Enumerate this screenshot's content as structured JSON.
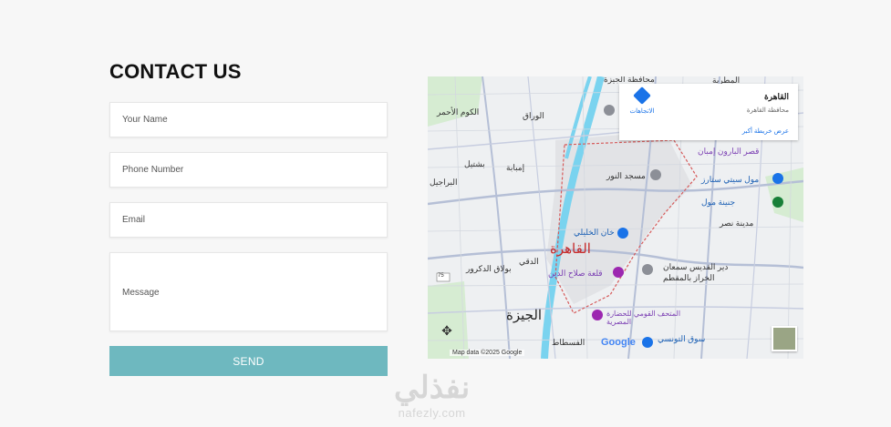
{
  "form": {
    "title": "CONTACT US",
    "name_placeholder": "Your Name",
    "phone_placeholder": "Phone Number",
    "email_placeholder": "Email",
    "message_placeholder": "Message",
    "send_label": "SEND"
  },
  "map": {
    "card_title": "القاهرة",
    "card_subtitle": "محافظة القاهرة",
    "directions_label": "الاتجاهات",
    "larger_map_link": "عرض خريطة أكبر",
    "city_label": "القاهرة",
    "giza_label": "الجيزة",
    "labels": {
      "giza_gov": "محافظة الجيزة",
      "mataria": "المطرية",
      "kom_ahmar": "الكوم الأحمر",
      "warraq": "الوراق",
      "bashtil": "بشتيل",
      "imbaba": "إمبابة",
      "barajil": "البراجيل",
      "nour_mosque": "مسجد النور",
      "baron_palace": "قصر البارون إمبان",
      "city_stars": "مول سيتي ستارز",
      "genena_mall": "جنينة مول",
      "nasr_city": "مدينة نصر",
      "khan_khalili": "خان الخليلي",
      "dokki": "الدقي",
      "doctors_tower": "بولاق الدكرور",
      "citadel": "قلعة صلاح الدين",
      "saint_simon": "دير القديس سمعان",
      "mokattam": "الخراز بالمقطم",
      "civ_museum": "المتحف القومي للحضارة المصرية",
      "souq": "سوق التونسي",
      "fustat": "الفسطاط"
    },
    "google_logo": "Google",
    "attribution": "Map data ©2025 Google",
    "route_badge": "75"
  },
  "watermark": {
    "arabic": "نفذلي",
    "latin": "nafezly.com"
  },
  "colors": {
    "send_button": "#6eb8bf",
    "link_blue": "#1a73e8",
    "city_red": "#c62828"
  }
}
